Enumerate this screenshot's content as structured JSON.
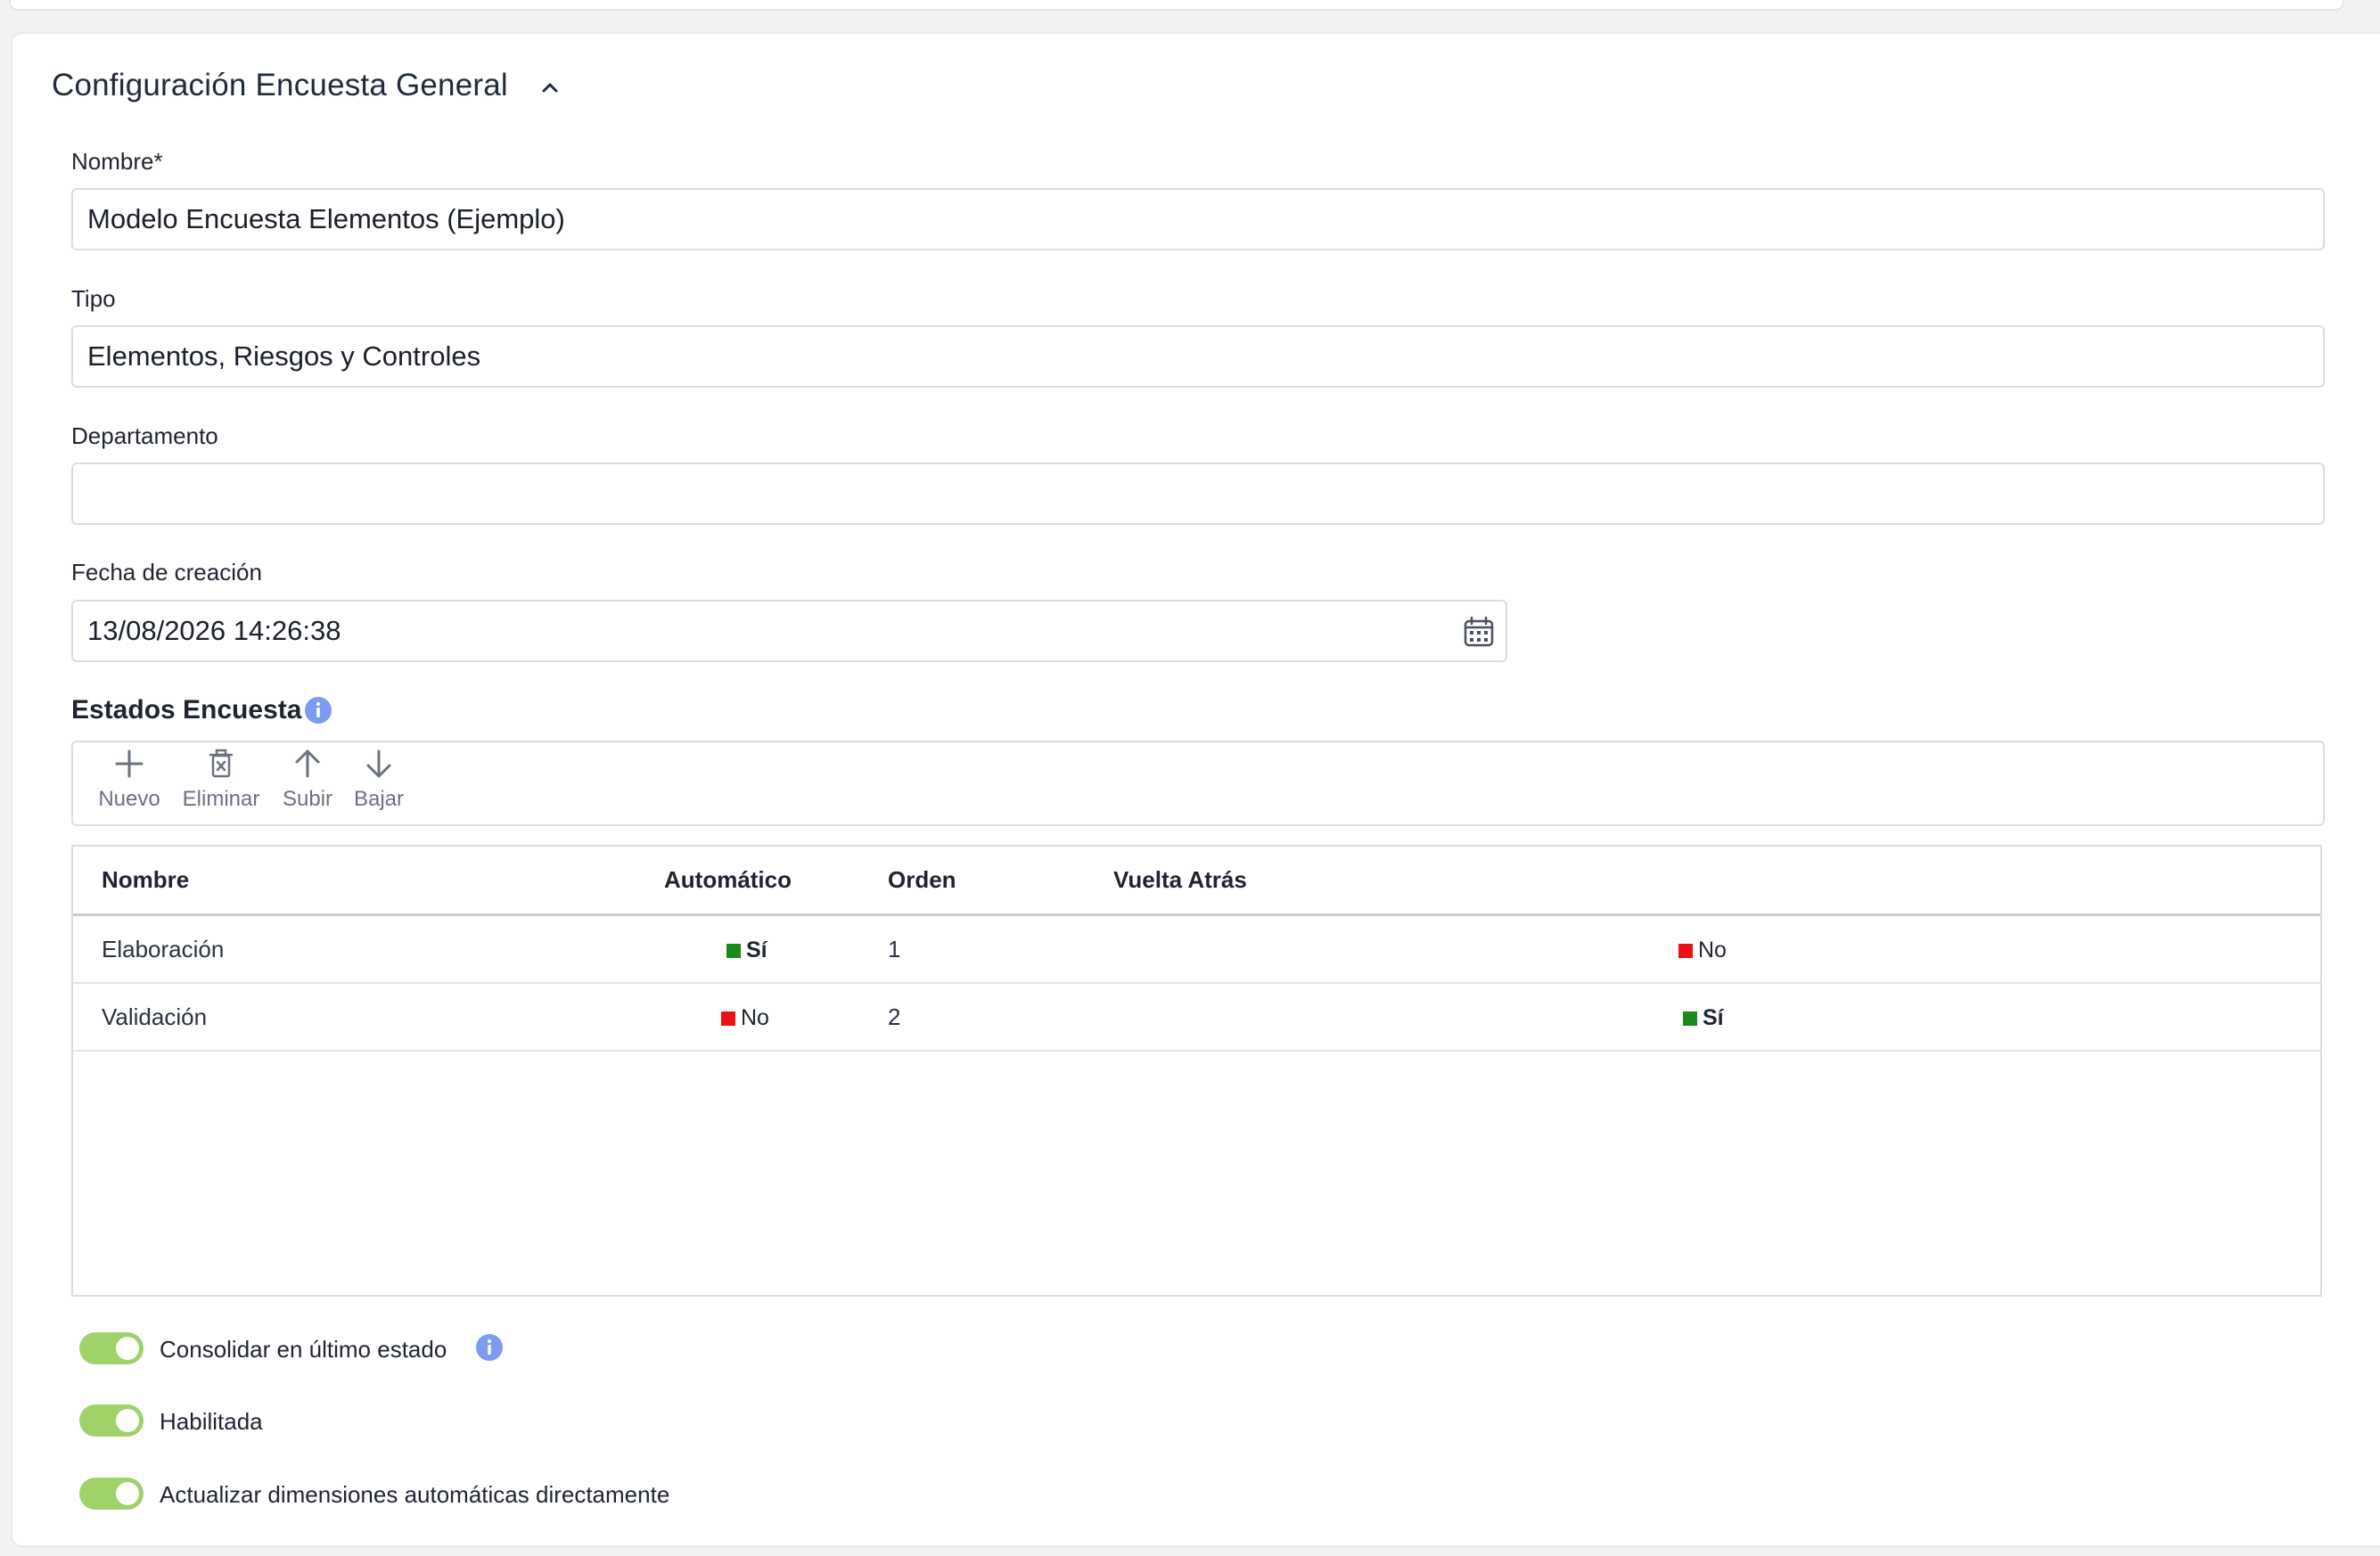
{
  "section": {
    "title": "Configuración Encuesta General"
  },
  "fields": {
    "nombre": {
      "label": "Nombre*",
      "value": "Modelo Encuesta Elementos (Ejemplo)"
    },
    "tipo": {
      "label": "Tipo",
      "value": "Elementos, Riesgos y Controles"
    },
    "departamento": {
      "label": "Departamento",
      "value": ""
    },
    "fecha": {
      "label": "Fecha de creación",
      "value": "13/08/2026 14:26:38"
    }
  },
  "estados": {
    "title": "Estados Encuesta",
    "toolbar": {
      "nuevo": "Nuevo",
      "eliminar": "Eliminar",
      "subir": "Subir",
      "bajar": "Bajar"
    },
    "columns": {
      "nombre": "Nombre",
      "automatico": "Automático",
      "orden": "Orden",
      "vuelta": "Vuelta Atrás"
    },
    "rows": [
      {
        "nombre": "Elaboración",
        "automatico": "Sí",
        "orden": "1",
        "vuelta": "No"
      },
      {
        "nombre": "Validación",
        "automatico": "No",
        "orden": "2",
        "vuelta": "Sí"
      }
    ]
  },
  "toggles": {
    "consolidar": {
      "label": "Consolidar en último estado",
      "on": true
    },
    "habilitada": {
      "label": "Habilitada",
      "on": true
    },
    "actualizar": {
      "label": "Actualizar dimensiones automáticas directamente",
      "on": true
    }
  },
  "colors": {
    "toggle_on": "#9fd36a",
    "yes": "#1a8a1a",
    "no": "#ee1111",
    "info": "#7b9cf0"
  }
}
